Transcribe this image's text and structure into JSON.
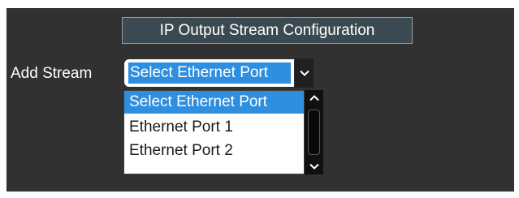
{
  "header": {
    "title": "IP Output Stream Configuration"
  },
  "add_stream": {
    "label": "Add Stream",
    "select": {
      "value": "Select Ethernet Port",
      "arrow_icon": "chevron-down-icon"
    },
    "dropdown": {
      "options": [
        {
          "label": "Select Ethernet Port",
          "selected": true
        },
        {
          "label": "Ethernet Port 1",
          "selected": false
        },
        {
          "label": "Ethernet Port 2",
          "selected": false
        }
      ],
      "scroll_up_icon": "chevron-up-icon",
      "scroll_down_icon": "chevron-down-icon"
    }
  },
  "colors": {
    "panel_background": "#313131",
    "header_background": "#3b4a52",
    "selection_highlight": "#2e8ee0"
  }
}
